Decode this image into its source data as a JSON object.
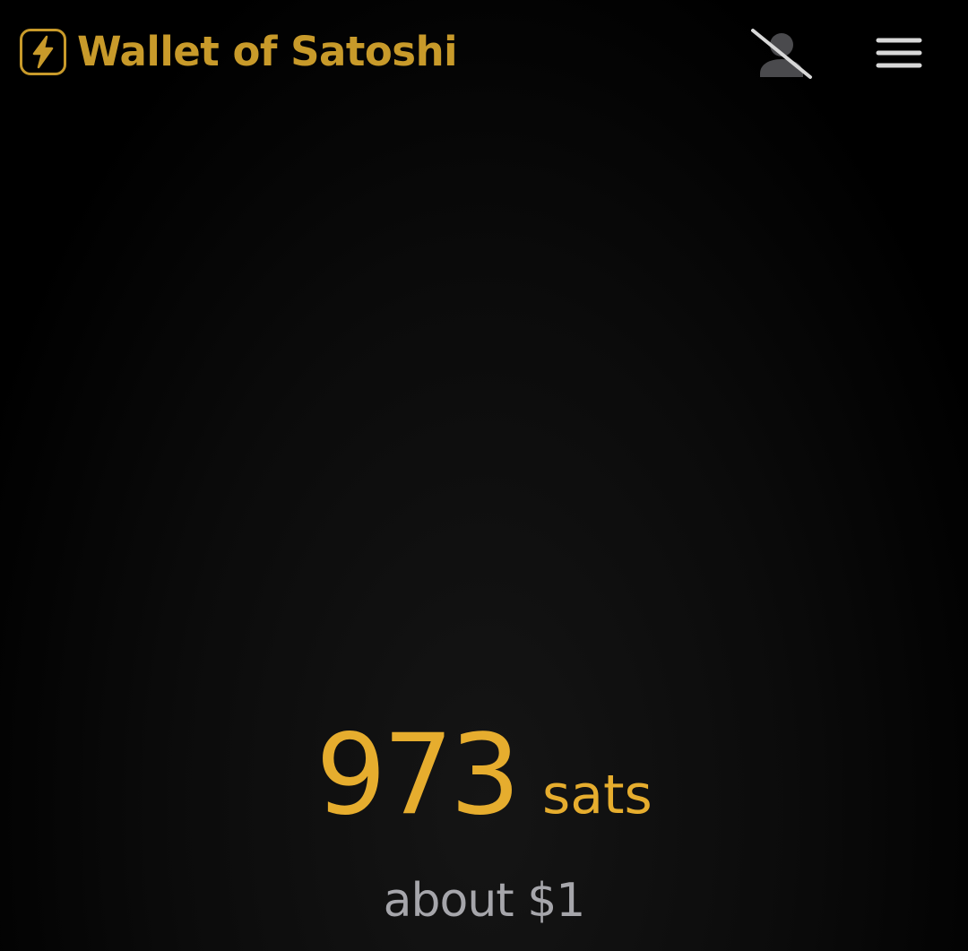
{
  "header": {
    "app_name": "Wallet of Satoshi",
    "logo_icon": "lightning-bolt-icon",
    "account_icon": "account-off-icon",
    "menu_icon": "hamburger-menu-icon"
  },
  "balance": {
    "amount": "973",
    "unit": "sats",
    "fiat_equivalent": "about $1"
  },
  "colors": {
    "brand_gold": "#c89a2a",
    "balance_yellow": "#e6ad2e",
    "muted_gray": "#a6a6ab",
    "icon_gray": "#4a4a4d",
    "menu_icon": "#d8d8d8",
    "background": "#050505"
  }
}
